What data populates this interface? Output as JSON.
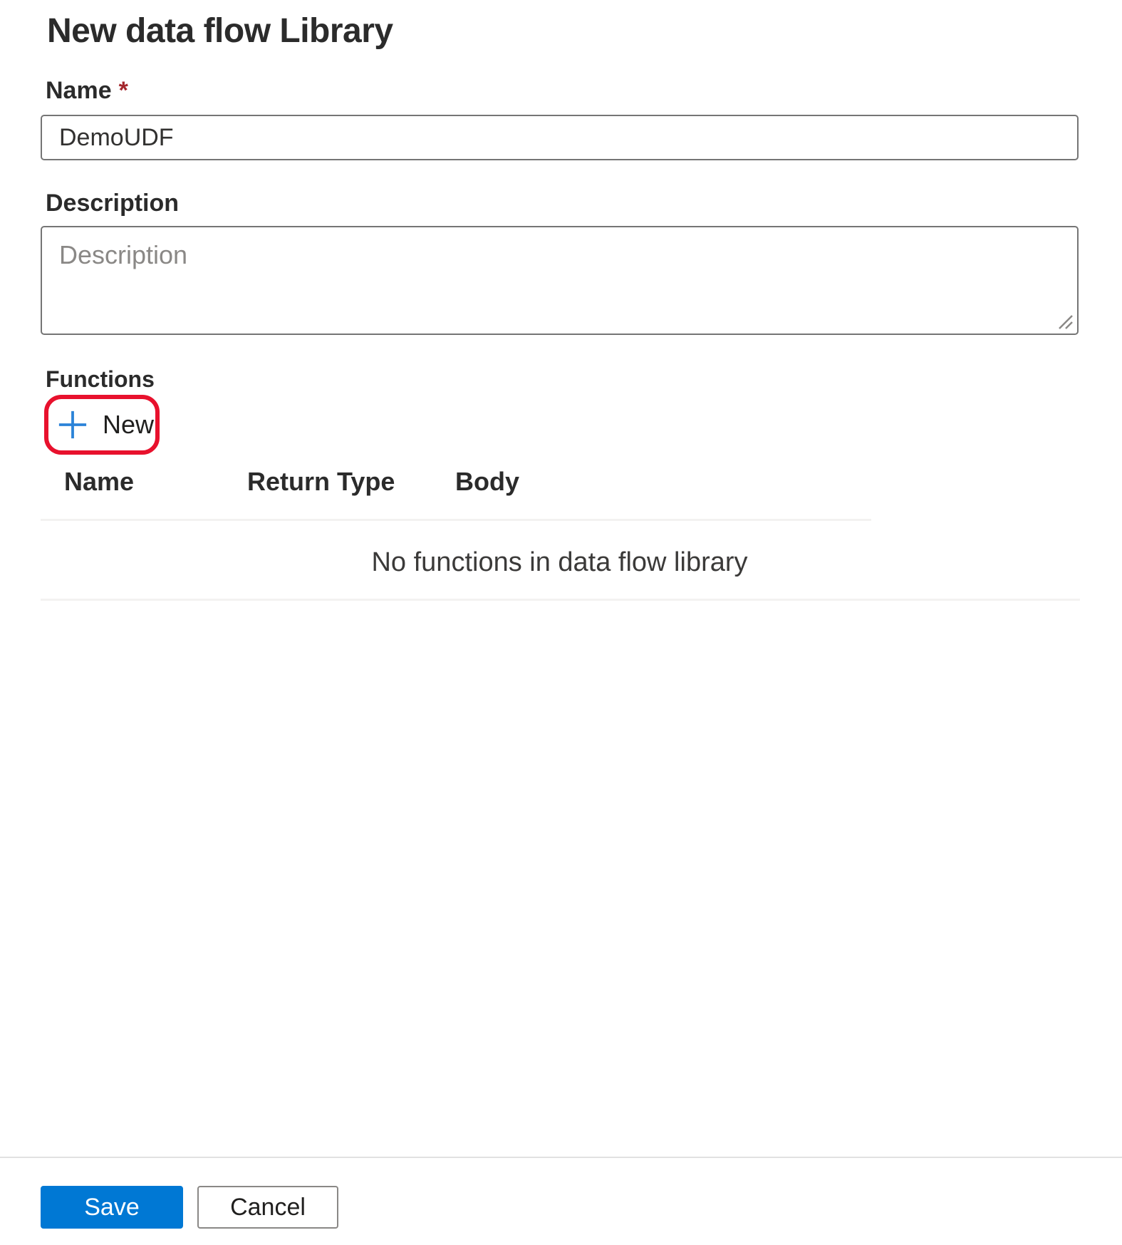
{
  "page": {
    "title": "New data flow Library"
  },
  "form": {
    "name": {
      "label": "Name",
      "required_marker": "*",
      "value": "DemoUDF"
    },
    "description": {
      "label": "Description",
      "placeholder": "Description",
      "value": ""
    }
  },
  "functions": {
    "label": "Functions",
    "new_button": {
      "label": "New",
      "icon": "plus-icon"
    },
    "table": {
      "columns": [
        "Name",
        "Return Type",
        "Body"
      ],
      "rows": [],
      "empty_message": "No functions in data flow library"
    }
  },
  "footer": {
    "save_label": "Save",
    "cancel_label": "Cancel"
  },
  "colors": {
    "accent_blue": "#0078d4",
    "plus_icon_blue": "#2b83d8",
    "annotation_red": "#e8112d",
    "required_red": "#a4262c",
    "divider_gray": "#f3f2f1"
  }
}
